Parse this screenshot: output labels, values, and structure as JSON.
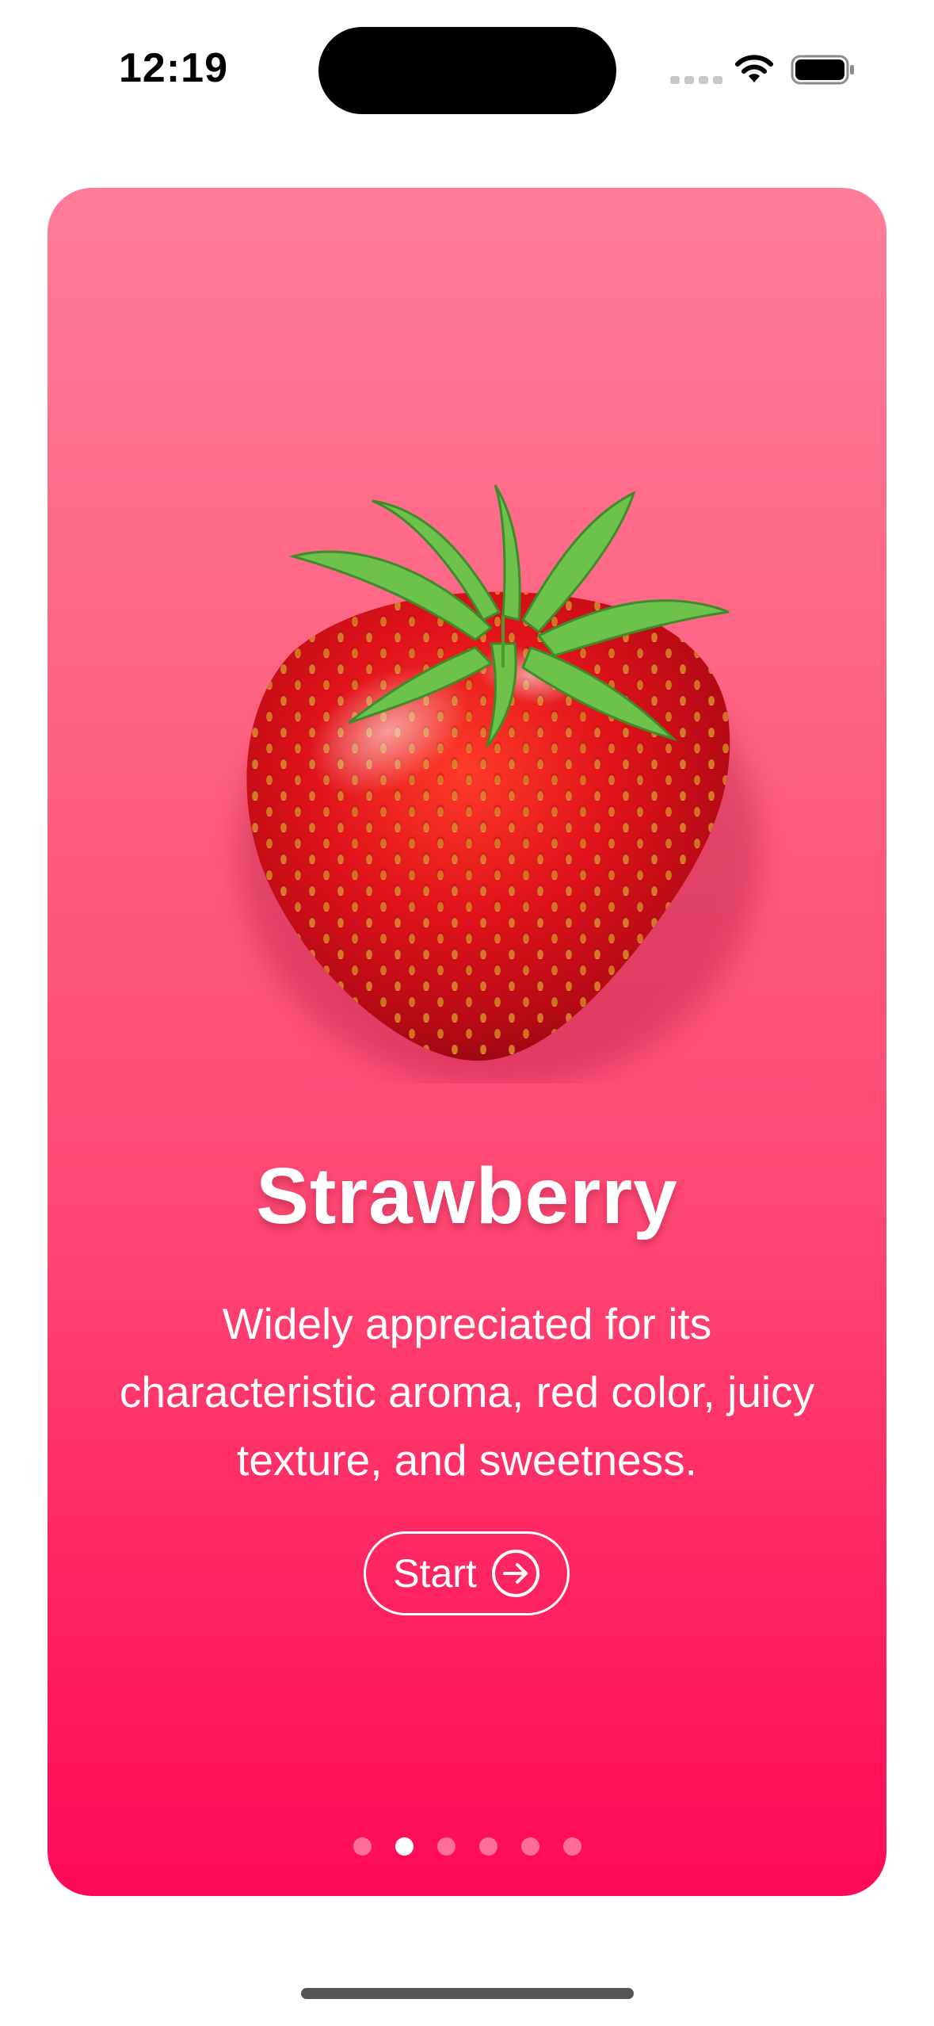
{
  "status_bar": {
    "time": "12:19",
    "icons": [
      "cellular-signal-icon",
      "wifi-icon",
      "battery-icon"
    ]
  },
  "slide": {
    "title": "Strawberry",
    "description": "Widely appreciated for its\ncharacteristic aroma,  red color, juicy\ntexture, and sweetness.",
    "start_label": "Start",
    "start_icon": "arrow-right-circle-icon",
    "image": "strawberry-image"
  },
  "pager": {
    "total": 6,
    "active_index": 1
  },
  "colors": {
    "gradient_top": "#ff7c98",
    "gradient_bottom": "#ff0a58",
    "text": "#ffffff"
  }
}
